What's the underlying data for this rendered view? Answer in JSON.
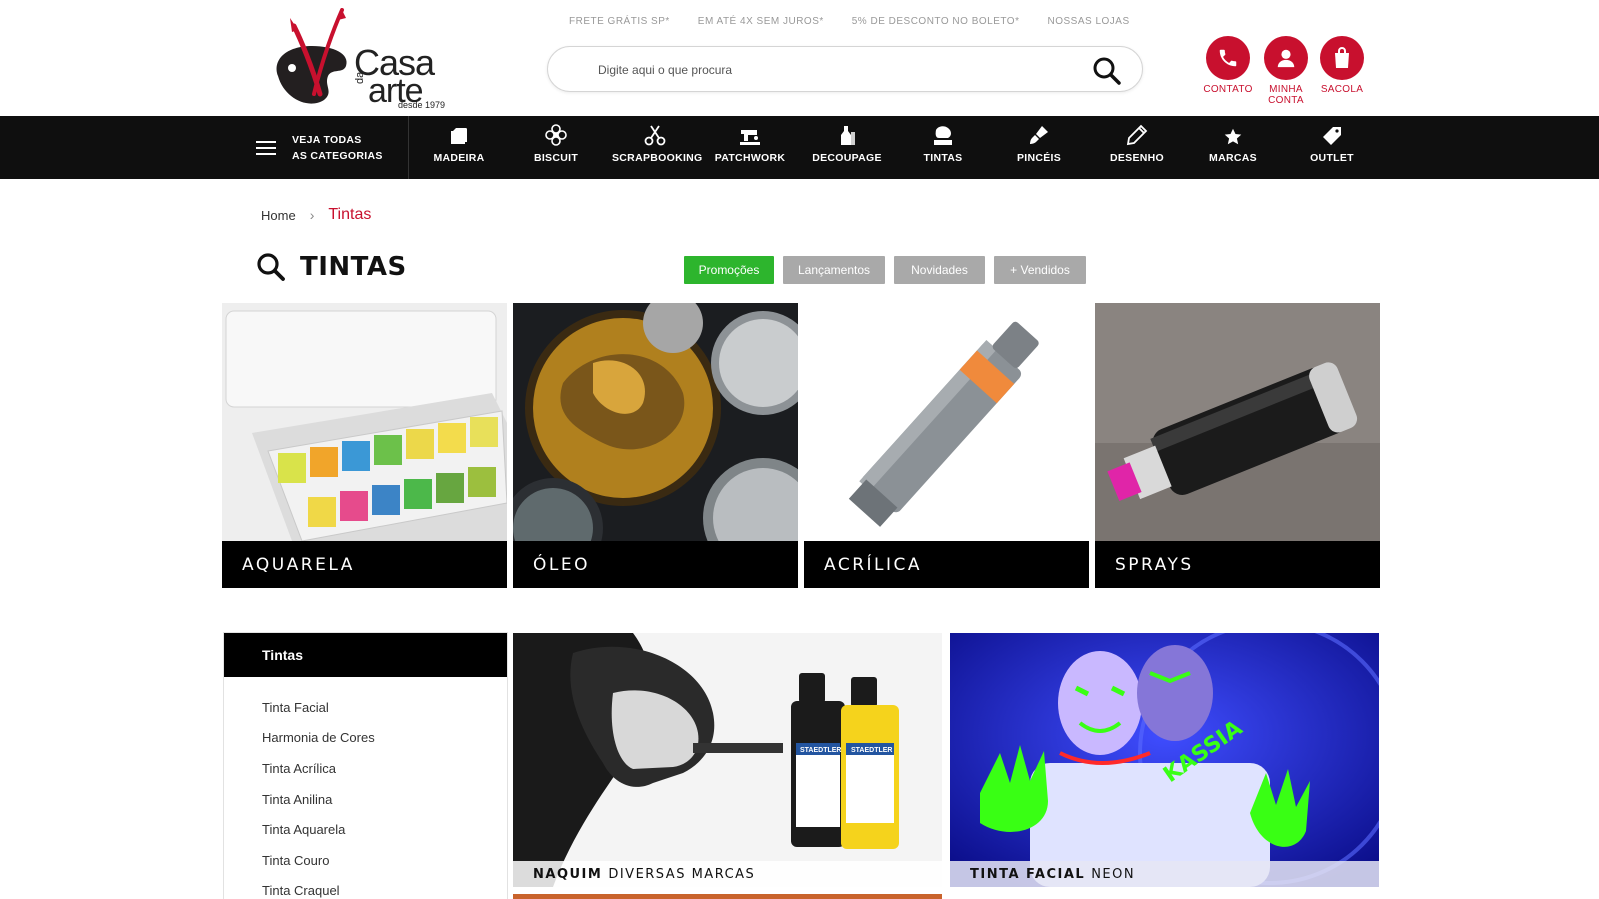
{
  "brand": {
    "logo_casa": "Casa",
    "logo_da": "da",
    "logo_arte": "arte",
    "logo_since": "desde 1979"
  },
  "topbar": {
    "links": [
      "FRETE GRÁTIS SP*",
      "EM ATÉ 4X SEM JUROS*",
      "5% DE DESCONTO NO BOLETO*",
      "NOSSAS LOJAS"
    ]
  },
  "search": {
    "placeholder": "Digite aqui o que procura",
    "value": ""
  },
  "header_actions": {
    "contact": "CONTATO",
    "account_line1": "MINHA",
    "account_line2": "CONTA",
    "bag": "SACOLA"
  },
  "nav": {
    "all_categories_line1": "VEJA TODAS",
    "all_categories_line2": "AS CATEGORIAS",
    "items": [
      {
        "label": "MADEIRA",
        "icon": "wood-box-icon"
      },
      {
        "label": "BISCUIT",
        "icon": "flower-icon"
      },
      {
        "label": "SCRAPBOOKING",
        "icon": "scissors-icon"
      },
      {
        "label": "PATCHWORK",
        "icon": "sewing-machine-icon"
      },
      {
        "label": "DECOUPAGE",
        "icon": "bottles-icon"
      },
      {
        "label": "TINTAS",
        "icon": "paint-icon"
      },
      {
        "label": "PINCÉIS",
        "icon": "brush-icon"
      },
      {
        "label": "DESENHO",
        "icon": "pencil-icon"
      },
      {
        "label": "MARCAS",
        "icon": "star-icon"
      },
      {
        "label": "OUTLET",
        "icon": "tag-icon"
      }
    ]
  },
  "breadcrumb": {
    "home": "Home",
    "separator": "›",
    "current": "Tintas"
  },
  "page": {
    "title": "TINTAS"
  },
  "filters": {
    "promocoes": "Promoções",
    "lancamentos": "Lançamentos",
    "novidades": "Novidades",
    "vendidos": "+ Vendidos"
  },
  "categories": [
    {
      "label": "AQUARELA"
    },
    {
      "label": "ÓLEO"
    },
    {
      "label": "ACRÍLICA"
    },
    {
      "label": "SPRAYS"
    }
  ],
  "sidebar": {
    "title": "Tintas",
    "items": [
      "Tinta Facial",
      "Harmonia de Cores",
      "Tinta Acrílica",
      "Tinta Anilina",
      "Tinta Aquarela",
      "Tinta Couro",
      "Tinta Craquel"
    ]
  },
  "banners": {
    "naquim_bold": "NAQUIM",
    "naquim_rest": "DIVERSAS MARCAS",
    "facial_bold": "TINTA FACIAL",
    "facial_rest": "NEON",
    "staedtler_1": "STAEDTLER",
    "staedtler_2": "STAEDTLER",
    "kassia": "KASSIA"
  },
  "colors": {
    "brand_red": "#c8102e",
    "nav_black": "#0f0f0f",
    "promo_green": "#2db52d",
    "filter_gray": "#a9a9a9"
  }
}
